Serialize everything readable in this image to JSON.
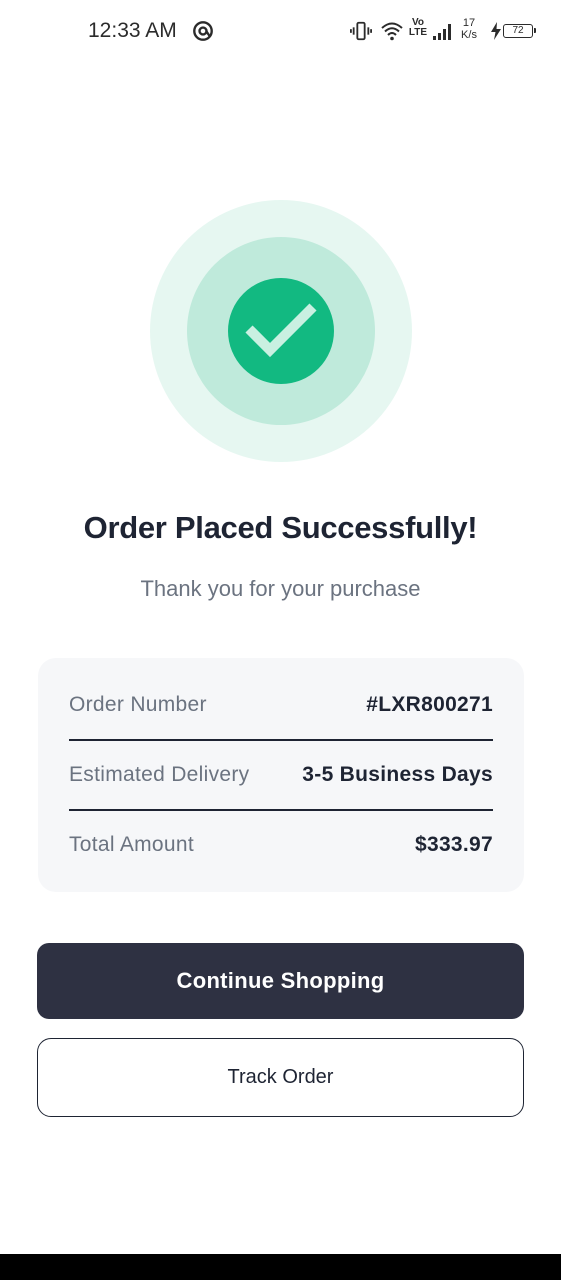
{
  "status_bar": {
    "time": "12:33 AM",
    "volte_label": "Vo\nLTE",
    "network_speed_value": "17",
    "network_speed_unit": "K/s",
    "battery_level": "72"
  },
  "success": {
    "title": "Order Placed Successfully!",
    "subtitle": "Thank you for your purchase"
  },
  "summary": {
    "rows": [
      {
        "label": "Order Number",
        "value": "#LXR800271"
      },
      {
        "label": "Estimated Delivery",
        "value": "3-5 Business Days"
      },
      {
        "label": "Total Amount",
        "value": "$333.97"
      }
    ]
  },
  "actions": {
    "primary_label": "Continue Shopping",
    "secondary_label": "Track Order"
  },
  "colors": {
    "accent_green": "#12b981",
    "primary_button": "#2e3142",
    "text_dark": "#1e2433",
    "text_muted": "#6b7380"
  }
}
